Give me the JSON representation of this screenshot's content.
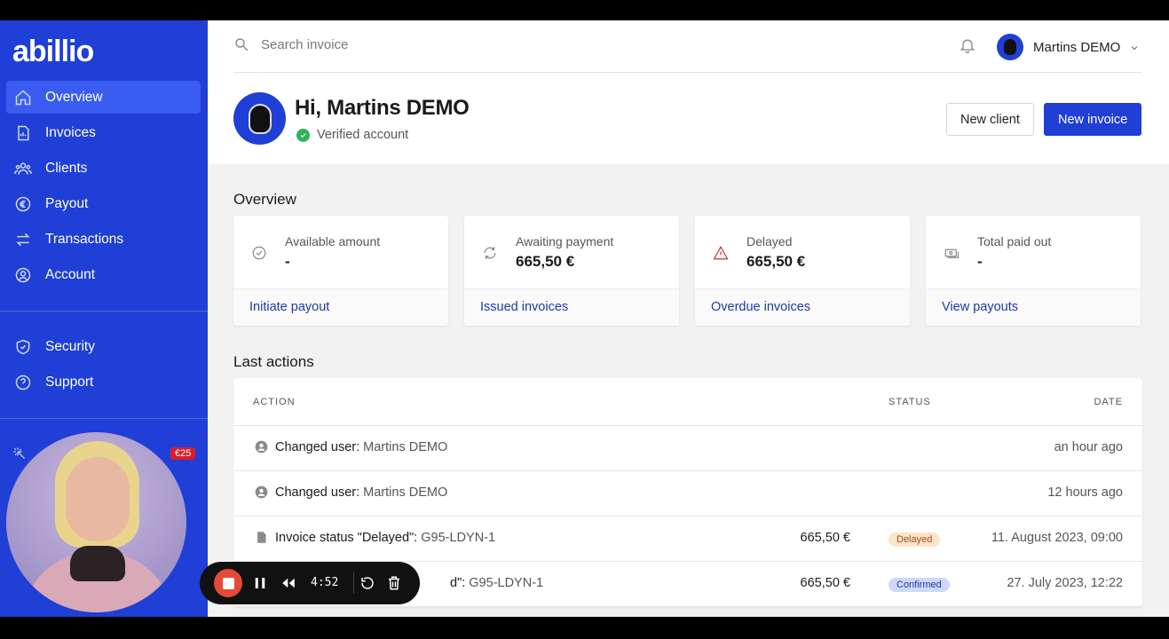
{
  "app": {
    "logo": "abillio"
  },
  "sidebar": {
    "items": [
      {
        "label": "Overview",
        "icon": "home-icon",
        "active": true
      },
      {
        "label": "Invoices",
        "icon": "invoice-icon"
      },
      {
        "label": "Clients",
        "icon": "users-icon"
      },
      {
        "label": "Payout",
        "icon": "euro-icon"
      },
      {
        "label": "Transactions",
        "icon": "arrows-icon"
      },
      {
        "label": "Account",
        "icon": "account-icon"
      }
    ],
    "items2": [
      {
        "label": "Security",
        "icon": "shield-icon"
      },
      {
        "label": "Support",
        "icon": "help-icon"
      }
    ],
    "badge": "€25"
  },
  "header": {
    "search_placeholder": "Search invoice",
    "user_name": "Martins DEMO",
    "greeting": "Hi, Martins DEMO",
    "verified": "Verified account",
    "new_client": "New client",
    "new_invoice": "New invoice"
  },
  "overview": {
    "title": "Overview",
    "cards": [
      {
        "label": "Available amount",
        "value": "-",
        "link": "Initiate payout",
        "icon": "check-circle-icon"
      },
      {
        "label": "Awaiting payment",
        "value": "665,50 €",
        "link": "Issued invoices",
        "icon": "refresh-icon"
      },
      {
        "label": "Delayed",
        "value": "665,50 €",
        "link": "Overdue invoices",
        "icon": "warning-icon"
      },
      {
        "label": "Total paid out",
        "value": "-",
        "link": "View payouts",
        "icon": "money-icon"
      }
    ]
  },
  "last_actions": {
    "title": "Last actions",
    "columns": {
      "action": "ACTION",
      "status": "STATUS",
      "date": "DATE"
    },
    "rows": [
      {
        "action": "Changed user:",
        "sub": "Martins DEMO",
        "amount": "",
        "status": "",
        "date": "an hour ago",
        "icon": "user-icon"
      },
      {
        "action": "Changed user:",
        "sub": "Martins DEMO",
        "amount": "",
        "status": "",
        "date": "12 hours ago",
        "icon": "user-icon"
      },
      {
        "action": "Invoice status \"Delayed\":",
        "sub": "G95-LDYN-1",
        "amount": "665,50 €",
        "status": "Delayed",
        "date": "11. August 2023, 09:00",
        "icon": "document-icon"
      },
      {
        "action": "d\":",
        "sub": "G95-LDYN-1",
        "amount": "665,50 €",
        "status": "Confirmed",
        "date": "27. July 2023, 12:22",
        "icon": "document-icon"
      }
    ]
  },
  "recorder": {
    "time": "4:52"
  },
  "colors": {
    "primary": "#1f3fd6",
    "sidebar_active": "#3a5cf0",
    "stop": "#e5493a"
  }
}
